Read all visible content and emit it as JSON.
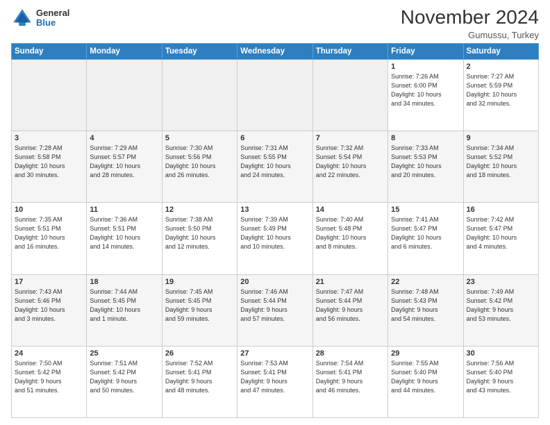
{
  "header": {
    "logo": {
      "general": "General",
      "blue": "Blue"
    },
    "title": "November 2024",
    "location": "Gumussu, Turkey"
  },
  "calendar": {
    "days_of_week": [
      "Sunday",
      "Monday",
      "Tuesday",
      "Wednesday",
      "Thursday",
      "Friday",
      "Saturday"
    ],
    "weeks": [
      [
        {
          "day": "",
          "info": ""
        },
        {
          "day": "",
          "info": ""
        },
        {
          "day": "",
          "info": ""
        },
        {
          "day": "",
          "info": ""
        },
        {
          "day": "",
          "info": ""
        },
        {
          "day": "1",
          "info": "Sunrise: 7:26 AM\nSunset: 6:00 PM\nDaylight: 10 hours\nand 34 minutes."
        },
        {
          "day": "2",
          "info": "Sunrise: 7:27 AM\nSunset: 5:59 PM\nDaylight: 10 hours\nand 32 minutes."
        }
      ],
      [
        {
          "day": "3",
          "info": "Sunrise: 7:28 AM\nSunset: 5:58 PM\nDaylight: 10 hours\nand 30 minutes."
        },
        {
          "day": "4",
          "info": "Sunrise: 7:29 AM\nSunset: 5:57 PM\nDaylight: 10 hours\nand 28 minutes."
        },
        {
          "day": "5",
          "info": "Sunrise: 7:30 AM\nSunset: 5:56 PM\nDaylight: 10 hours\nand 26 minutes."
        },
        {
          "day": "6",
          "info": "Sunrise: 7:31 AM\nSunset: 5:55 PM\nDaylight: 10 hours\nand 24 minutes."
        },
        {
          "day": "7",
          "info": "Sunrise: 7:32 AM\nSunset: 5:54 PM\nDaylight: 10 hours\nand 22 minutes."
        },
        {
          "day": "8",
          "info": "Sunrise: 7:33 AM\nSunset: 5:53 PM\nDaylight: 10 hours\nand 20 minutes."
        },
        {
          "day": "9",
          "info": "Sunrise: 7:34 AM\nSunset: 5:52 PM\nDaylight: 10 hours\nand 18 minutes."
        }
      ],
      [
        {
          "day": "10",
          "info": "Sunrise: 7:35 AM\nSunset: 5:51 PM\nDaylight: 10 hours\nand 16 minutes."
        },
        {
          "day": "11",
          "info": "Sunrise: 7:36 AM\nSunset: 5:51 PM\nDaylight: 10 hours\nand 14 minutes."
        },
        {
          "day": "12",
          "info": "Sunrise: 7:38 AM\nSunset: 5:50 PM\nDaylight: 10 hours\nand 12 minutes."
        },
        {
          "day": "13",
          "info": "Sunrise: 7:39 AM\nSunset: 5:49 PM\nDaylight: 10 hours\nand 10 minutes."
        },
        {
          "day": "14",
          "info": "Sunrise: 7:40 AM\nSunset: 5:48 PM\nDaylight: 10 hours\nand 8 minutes."
        },
        {
          "day": "15",
          "info": "Sunrise: 7:41 AM\nSunset: 5:47 PM\nDaylight: 10 hours\nand 6 minutes."
        },
        {
          "day": "16",
          "info": "Sunrise: 7:42 AM\nSunset: 5:47 PM\nDaylight: 10 hours\nand 4 minutes."
        }
      ],
      [
        {
          "day": "17",
          "info": "Sunrise: 7:43 AM\nSunset: 5:46 PM\nDaylight: 10 hours\nand 3 minutes."
        },
        {
          "day": "18",
          "info": "Sunrise: 7:44 AM\nSunset: 5:45 PM\nDaylight: 10 hours\nand 1 minute."
        },
        {
          "day": "19",
          "info": "Sunrise: 7:45 AM\nSunset: 5:45 PM\nDaylight: 9 hours\nand 59 minutes."
        },
        {
          "day": "20",
          "info": "Sunrise: 7:46 AM\nSunset: 5:44 PM\nDaylight: 9 hours\nand 57 minutes."
        },
        {
          "day": "21",
          "info": "Sunrise: 7:47 AM\nSunset: 5:44 PM\nDaylight: 9 hours\nand 56 minutes."
        },
        {
          "day": "22",
          "info": "Sunrise: 7:48 AM\nSunset: 5:43 PM\nDaylight: 9 hours\nand 54 minutes."
        },
        {
          "day": "23",
          "info": "Sunrise: 7:49 AM\nSunset: 5:42 PM\nDaylight: 9 hours\nand 53 minutes."
        }
      ],
      [
        {
          "day": "24",
          "info": "Sunrise: 7:50 AM\nSunset: 5:42 PM\nDaylight: 9 hours\nand 51 minutes."
        },
        {
          "day": "25",
          "info": "Sunrise: 7:51 AM\nSunset: 5:42 PM\nDaylight: 9 hours\nand 50 minutes."
        },
        {
          "day": "26",
          "info": "Sunrise: 7:52 AM\nSunset: 5:41 PM\nDaylight: 9 hours\nand 48 minutes."
        },
        {
          "day": "27",
          "info": "Sunrise: 7:53 AM\nSunset: 5:41 PM\nDaylight: 9 hours\nand 47 minutes."
        },
        {
          "day": "28",
          "info": "Sunrise: 7:54 AM\nSunset: 5:41 PM\nDaylight: 9 hours\nand 46 minutes."
        },
        {
          "day": "29",
          "info": "Sunrise: 7:55 AM\nSunset: 5:40 PM\nDaylight: 9 hours\nand 44 minutes."
        },
        {
          "day": "30",
          "info": "Sunrise: 7:56 AM\nSunset: 5:40 PM\nDaylight: 9 hours\nand 43 minutes."
        }
      ]
    ]
  }
}
